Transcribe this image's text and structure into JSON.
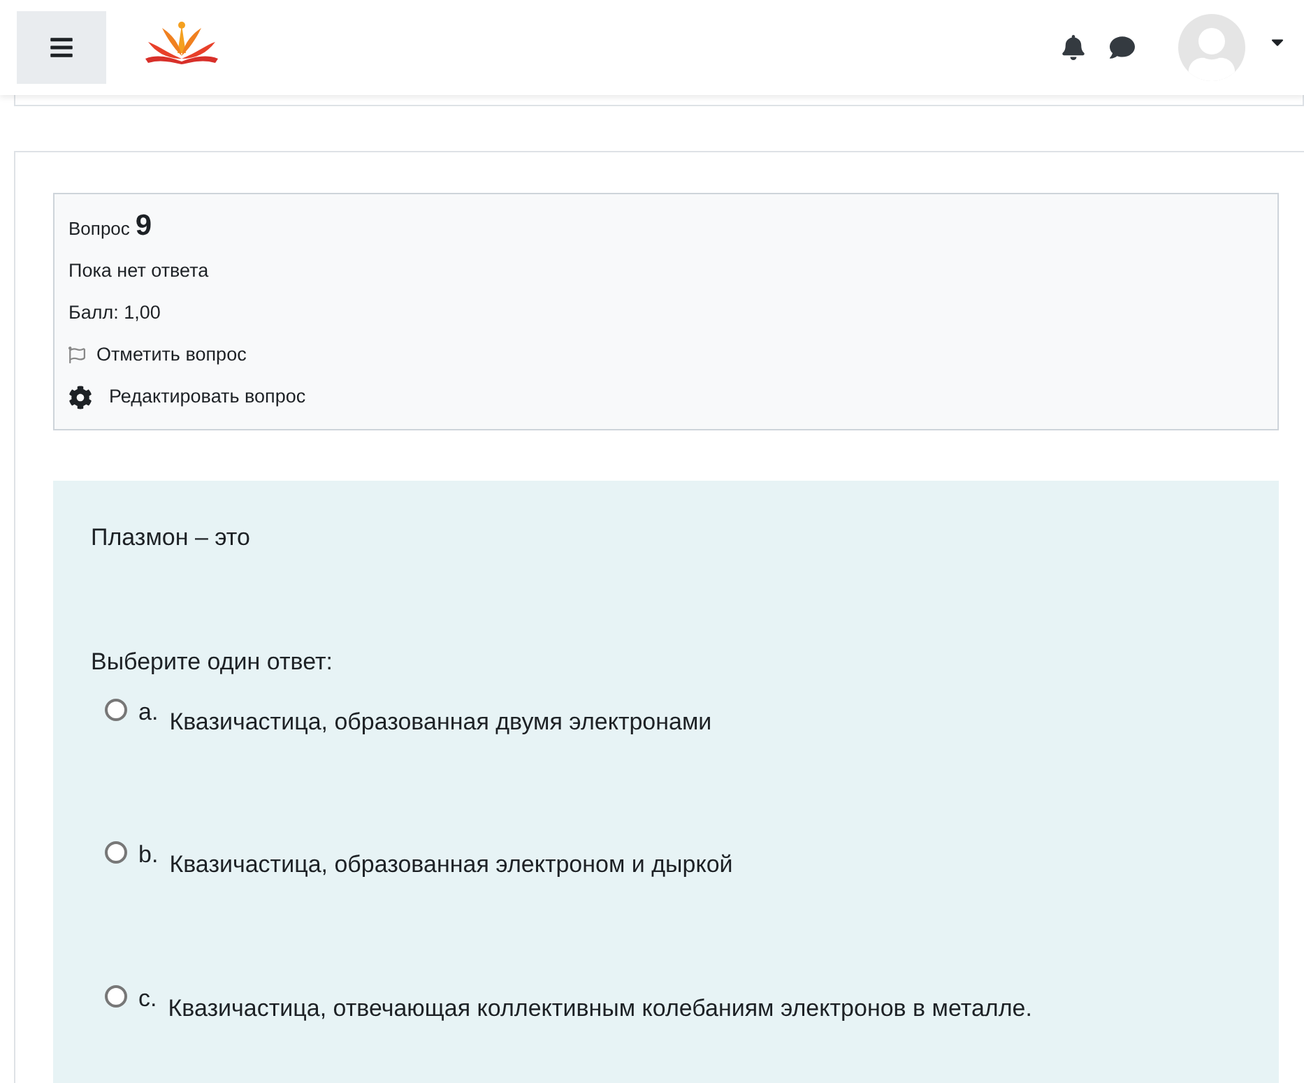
{
  "question_info": {
    "label": "Вопрос",
    "number": "9",
    "status": "Пока нет ответа",
    "mark": "Балл: 1,00",
    "flag_link": "Отметить вопрос",
    "flagged": false,
    "edit_link": "Редактировать вопрос"
  },
  "question": {
    "text": "Плазмон – это",
    "prompt": "Выберите один ответ:",
    "options": [
      {
        "letter": "a.",
        "text": "Квазичастица, образованная двумя электронами",
        "selected": false
      },
      {
        "letter": "b.",
        "text": "Квазичастица, образованная электроном и дыркой",
        "selected": false
      },
      {
        "letter": "c.",
        "text": "Квазичастица, отвечающая коллективным колебаниям электронов в металле.",
        "selected": false
      }
    ]
  }
}
